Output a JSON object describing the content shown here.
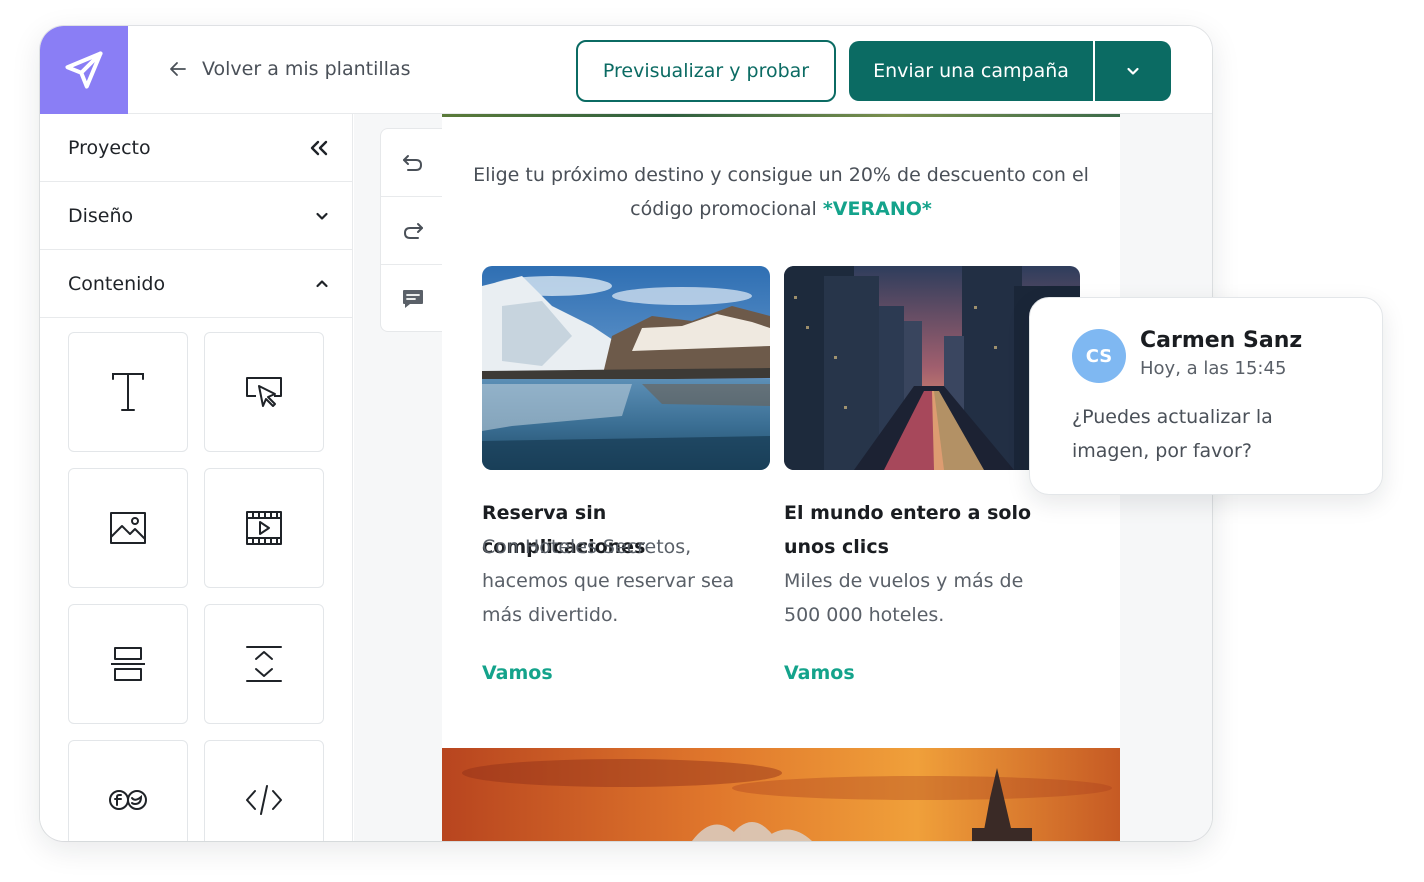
{
  "header": {
    "logo_icon": "paper-plane-icon",
    "back_label": "Volver a mis plantillas",
    "preview_label": "Previsualizar y probar",
    "send_label": "Enviar una campaña",
    "accent_color": "#0b6b63",
    "logo_color": "#8a7ef5"
  },
  "sidebar": {
    "sections": [
      {
        "label": "Proyecto",
        "icon": "collapse-double-chevron-left-icon"
      },
      {
        "label": "Diseño",
        "icon": "chevron-down-icon"
      },
      {
        "label": "Contenido",
        "icon": "chevron-up-icon"
      }
    ],
    "blocks": [
      "text-block-icon",
      "button-block-icon",
      "image-block-icon",
      "video-block-icon",
      "divider-block-icon",
      "spacer-block-icon",
      "social-block-icon",
      "html-code-block-icon"
    ]
  },
  "toolbar": {
    "tools": [
      "undo-icon",
      "redo-icon",
      "comment-icon"
    ]
  },
  "email": {
    "intro_text": "Elige tu próximo destino y consigue un 20% de descuento con el código promocional ",
    "promo_code": "*VERANO*",
    "cards": [
      {
        "title": "Reserva sin complicaciones",
        "text": "Con Hoteles Secretos, hacemos que reservar sea más divertido.",
        "link": "Vamos"
      },
      {
        "title": "El mundo entero a solo unos clics",
        "text": "Miles de vuelos y más de 500 000 hoteles.",
        "link": "Vamos"
      }
    ],
    "link_color": "#14a38b"
  },
  "comment": {
    "initials": "CS",
    "author": "Carmen Sanz",
    "time": "Hoy, a las 15:45",
    "message": "¿Puedes actualizar la imagen, por favor?"
  }
}
